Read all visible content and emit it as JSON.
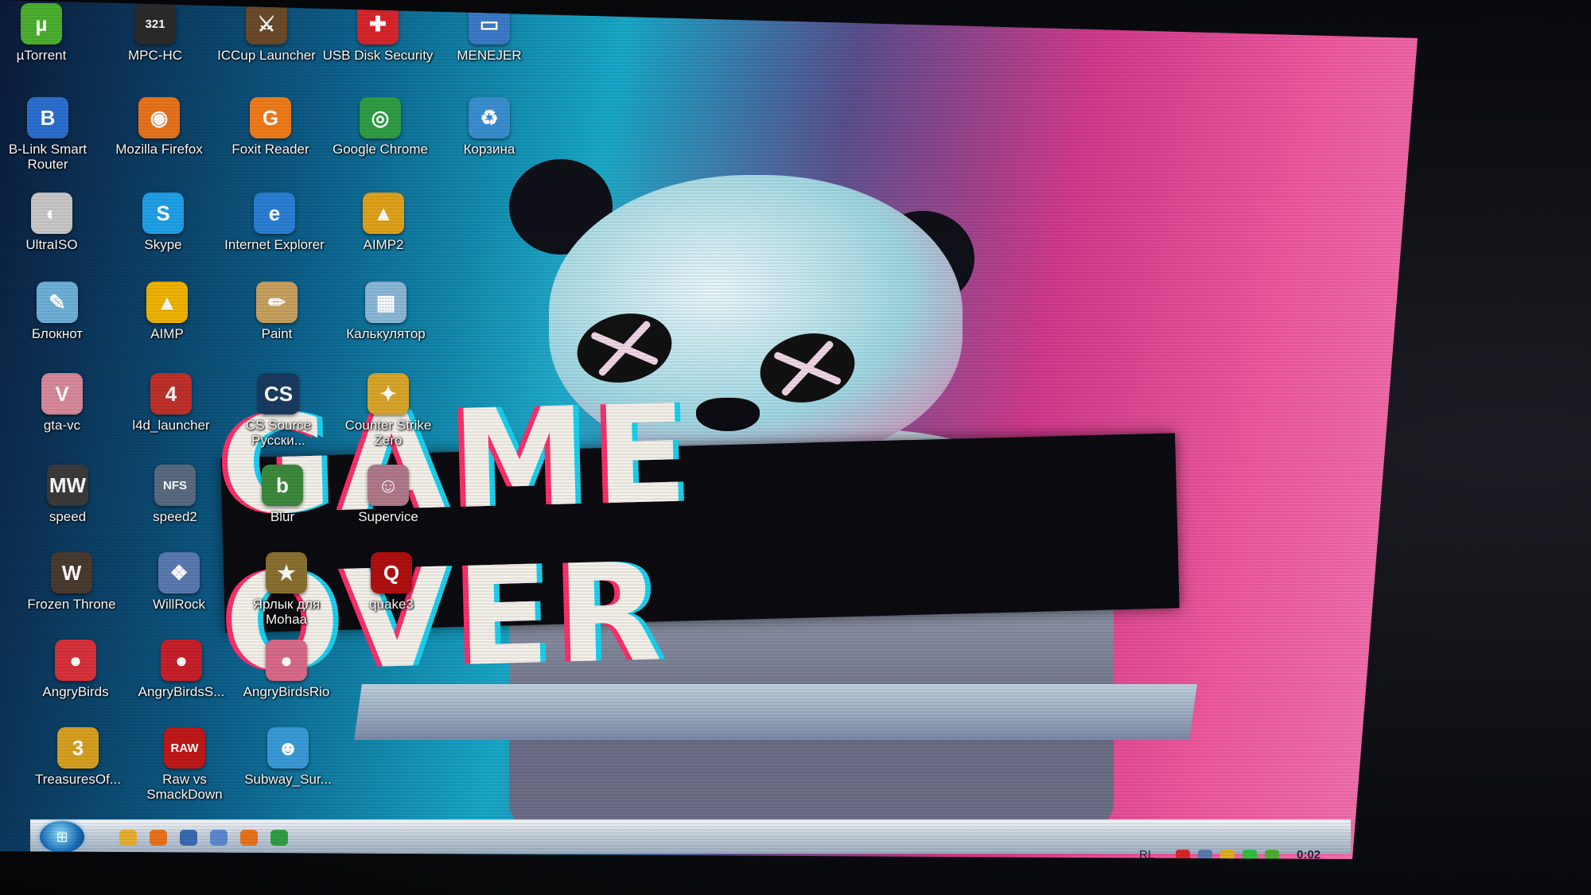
{
  "desktop": {
    "wallpaper_text": "GAME OVER",
    "icons": [
      {
        "label": "µTorrent",
        "icon": "utorrent-icon",
        "glyph": "µ",
        "color": "#4caf2f"
      },
      {
        "label": "MPC-HC",
        "icon": "mpc-hc-icon",
        "glyph": "321",
        "color": "#2a2a2a"
      },
      {
        "label": "ICCup Launcher",
        "icon": "iccup-icon",
        "glyph": "⚔",
        "color": "#6b4a2a"
      },
      {
        "label": "USB Disk Security",
        "icon": "shield-icon",
        "glyph": "✚",
        "color": "#d7262c"
      },
      {
        "label": "MENEJER",
        "icon": "monitor-icon",
        "glyph": "▭",
        "color": "#3b7bc8"
      },
      {
        "label": "B-Link Smart Router",
        "icon": "router-icon",
        "glyph": "B",
        "color": "#2b6fd0"
      },
      {
        "label": "Mozilla Firefox",
        "icon": "firefox-icon",
        "glyph": "◉",
        "color": "#e8731c"
      },
      {
        "label": "Foxit Reader",
        "icon": "foxit-icon",
        "glyph": "G",
        "color": "#f07c1b"
      },
      {
        "label": "Google Chrome",
        "icon": "chrome-icon",
        "glyph": "◎",
        "color": "#2f9e44"
      },
      {
        "label": "Корзина",
        "icon": "recycle-bin-icon",
        "glyph": "♻",
        "color": "#3a8fd0"
      },
      {
        "label": "UltraISO",
        "icon": "disc-icon",
        "glyph": "◐",
        "color": "#c9c9c9"
      },
      {
        "label": "Skype",
        "icon": "skype-icon",
        "glyph": "S",
        "color": "#1fa1e8"
      },
      {
        "label": "Internet Explorer",
        "icon": "ie-icon",
        "glyph": "e",
        "color": "#2a7fd4"
      },
      {
        "label": "AIMP2",
        "icon": "aimp2-icon",
        "glyph": "▲",
        "color": "#e0a21a"
      },
      {
        "label": "Блокнот",
        "icon": "notepad-icon",
        "glyph": "✎",
        "color": "#6fb0d8"
      },
      {
        "label": "AIMP",
        "icon": "aimp-icon",
        "glyph": "▲",
        "color": "#f0b400"
      },
      {
        "label": "Paint",
        "icon": "paint-icon",
        "glyph": "✏",
        "color": "#c8a060"
      },
      {
        "label": "Калькулятор",
        "icon": "calculator-icon",
        "glyph": "▦",
        "color": "#8ab8d8"
      },
      {
        "label": "gta-vc",
        "icon": "gta-icon",
        "glyph": "V",
        "color": "#d88a9a"
      },
      {
        "label": "l4d_launcher",
        "icon": "l4d-icon",
        "glyph": "4",
        "color": "#c0302a"
      },
      {
        "label": "CS Source Русски...",
        "icon": "css-icon",
        "glyph": "CS",
        "color": "#1a3a60"
      },
      {
        "label": "Counter Strike Zero",
        "icon": "cs-zero-icon",
        "glyph": "✦",
        "color": "#d9a62a"
      },
      {
        "label": "speed",
        "icon": "nfs-mw-icon",
        "glyph": "MW",
        "color": "#3a3a3a"
      },
      {
        "label": "speed2",
        "icon": "nfs-icon",
        "glyph": "NFS",
        "color": "#5a6a80"
      },
      {
        "label": "Blur",
        "icon": "blur-icon",
        "glyph": "b",
        "color": "#3c8a3c"
      },
      {
        "label": "Supervice",
        "icon": "supervice-icon",
        "glyph": "☺",
        "color": "#b07a8a"
      },
      {
        "label": "Frozen Throne",
        "icon": "warcraft-icon",
        "glyph": "W",
        "color": "#4a3a30"
      },
      {
        "label": "WillRock",
        "icon": "willrock-icon",
        "glyph": "❖",
        "color": "#5a7ab0"
      },
      {
        "label": "Ярлык для Mohaa",
        "icon": "mohaa-icon",
        "glyph": "★",
        "color": "#8a7030"
      },
      {
        "label": "quake3",
        "icon": "quake-icon",
        "glyph": "Q",
        "color": "#b01010"
      },
      {
        "label": "AngryBirds",
        "icon": "angrybirds-icon",
        "glyph": "●",
        "color": "#d8323a"
      },
      {
        "label": "AngryBirdsS...",
        "icon": "angrybirds-space-icon",
        "glyph": "●",
        "color": "#c8202a"
      },
      {
        "label": "AngryBirdsRio",
        "icon": "angrybirds-rio-icon",
        "glyph": "●",
        "color": "#d86a8a"
      },
      {
        "label": "TreasuresOf...",
        "icon": "treasures-icon",
        "glyph": "3",
        "color": "#d8a020"
      },
      {
        "label": "Raw vs SmackDown",
        "icon": "raw-icon",
        "glyph": "RAW",
        "color": "#c01818"
      },
      {
        "label": "Subway_Sur...",
        "icon": "subway-surfers-icon",
        "glyph": "☻",
        "color": "#3a9ad8"
      }
    ]
  },
  "taskbar": {
    "language": "RL",
    "clock": "0:02",
    "quick_launch": [
      "explorer-folder-icon",
      "firefox-icon",
      "save-icon",
      "show-desktop-icon",
      "firefox-icon",
      "chrome-icon"
    ],
    "tray": [
      "usb-security-tray-icon",
      "network-tray-icon",
      "aimp-tray-icon",
      "battery-tray-icon",
      "utorrent-tray-icon"
    ]
  }
}
